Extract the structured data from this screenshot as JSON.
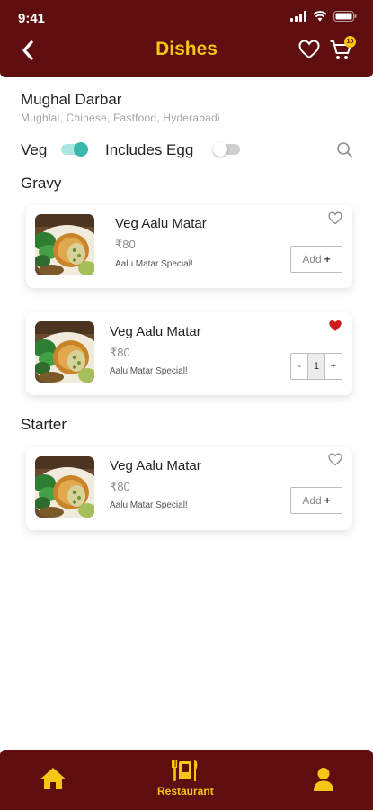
{
  "status": {
    "time": "9:41"
  },
  "header": {
    "title": "Dishes",
    "cart_count": "10"
  },
  "restaurant": {
    "name": "Mughal Darbar",
    "cuisines": "Mughlai, Chinese, Fastfood, Hyderabadi"
  },
  "filters": {
    "veg_label": "Veg",
    "veg_on": true,
    "egg_label": "Includes Egg",
    "egg_on": false
  },
  "sections": [
    {
      "title": "Gravy",
      "items": [
        {
          "name": "Veg Aalu Matar",
          "price": "₹80",
          "desc": "Aalu Matar Special!",
          "favorite": false,
          "in_cart": false,
          "add_label": "Add",
          "add_plus": "+"
        },
        {
          "name": "Veg Aalu Matar",
          "price": "₹80",
          "desc": "Aalu Matar Special!",
          "favorite": true,
          "in_cart": true,
          "qty": "1",
          "minus": "-",
          "plus": "+"
        }
      ]
    },
    {
      "title": "Starter",
      "items": [
        {
          "name": "Veg Aalu Matar",
          "price": "₹80",
          "desc": "Aalu Matar Special!",
          "favorite": false,
          "in_cart": false,
          "add_label": "Add",
          "add_plus": "+"
        }
      ]
    }
  ],
  "tabbar": {
    "active_label": "Restaurant"
  },
  "colors": {
    "brand": "#5e0e0e",
    "accent": "#f5c518",
    "toggle_on": "#3bb8ad",
    "favorite": "#d11a1a"
  },
  "icons": [
    "back-arrow-icon",
    "heart-outline-icon",
    "cart-icon",
    "search-icon",
    "heart-filled-icon",
    "home-icon",
    "restaurant-icon",
    "user-icon"
  ]
}
